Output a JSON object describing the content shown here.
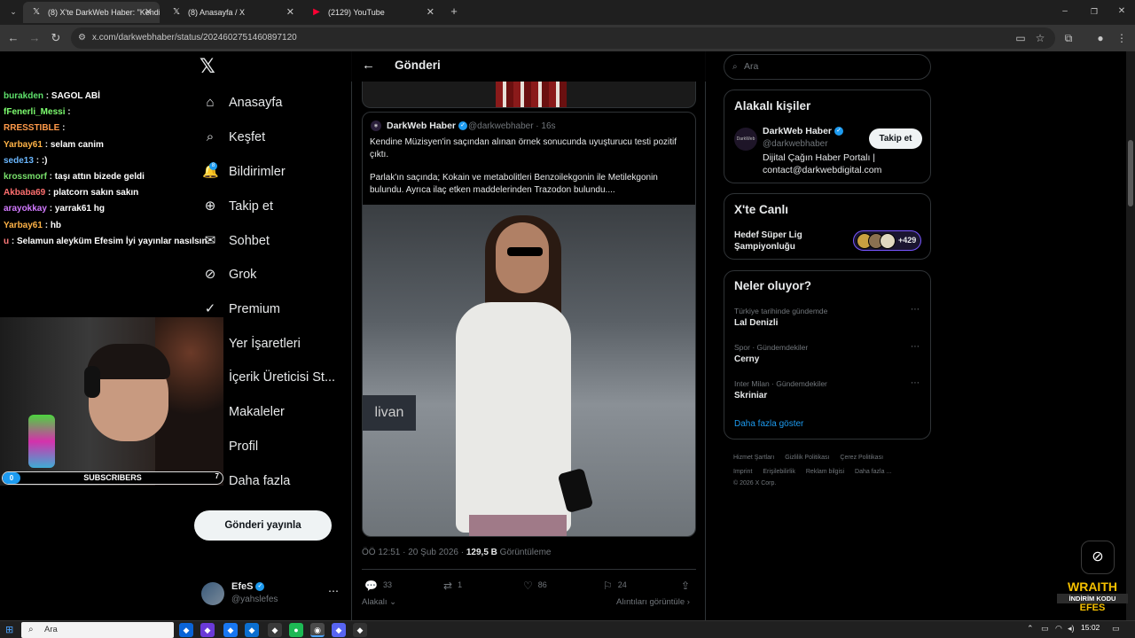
{
  "browser": {
    "tabs": [
      {
        "title": "(8) X'te DarkWeb Haber: \"Kendi",
        "favicon": "x-icon",
        "active": true
      },
      {
        "title": "(8) Anasayfa / X",
        "favicon": "x-icon",
        "active": false
      },
      {
        "title": "(2129) YouTube",
        "favicon": "youtube-icon",
        "active": false
      }
    ],
    "new_tab_label": "+",
    "url": "x.com/darkwebhaber/status/2024602751460897120"
  },
  "chat": [
    {
      "user": "burakden",
      "color": "#5ee06b",
      "message": "SAGOL ABİ"
    },
    {
      "user": "fFenerli_Messi",
      "color": "#7dff6f",
      "message": ""
    },
    {
      "user": "RRESSTIBLE",
      "color": "#ff9a4a",
      "message": ""
    },
    {
      "user": "Yarbay61",
      "color": "#ffb347",
      "message": "selam canim"
    },
    {
      "user": "sede13",
      "color": "#6ab7ff",
      "message": ":)"
    },
    {
      "user": "krossmorf",
      "color": "#78e06b",
      "message": "taşı attın bizede geldi"
    },
    {
      "user": "Akbaba69",
      "color": "#ff6f6f",
      "message": "platcorn sakın sakın"
    },
    {
      "user": "arayokkay",
      "color": "#d27aff",
      "message": "yarrak61 hg"
    },
    {
      "user": "Yarbay61",
      "color": "#ffb347",
      "message": "hb"
    },
    {
      "user": "u",
      "color": "#ff7a7a",
      "message": "Selamun aleyküm Efesim İyi yayınlar nasılsın."
    }
  ],
  "subscribers": {
    "count": "0",
    "label": "SUBSCRIBERS",
    "goal": "7"
  },
  "nav": {
    "items": [
      {
        "label": "Anasayfa",
        "icon": "home-icon",
        "glyph": "⌂"
      },
      {
        "label": "Keşfet",
        "icon": "search-icon",
        "glyph": "⌕"
      },
      {
        "label": "Bildirimler",
        "icon": "bell-icon",
        "glyph": "🔔"
      },
      {
        "label": "Takip et",
        "icon": "follow-icon",
        "glyph": "⊕"
      },
      {
        "label": "Sohbet",
        "icon": "mail-icon",
        "glyph": "✉"
      },
      {
        "label": "Grok",
        "icon": "grok-icon",
        "glyph": "⊘"
      },
      {
        "label": "Premium",
        "icon": "premium-icon",
        "glyph": "✓"
      },
      {
        "label": "Yer İşaretleri",
        "icon": "bookmark-icon",
        "glyph": "⚑"
      },
      {
        "label": "İçerik Üreticisi St...",
        "icon": "creator-icon",
        "glyph": "▤"
      },
      {
        "label": "Makaleler",
        "icon": "articles-icon",
        "glyph": "▦"
      },
      {
        "label": "Profil",
        "icon": "profile-icon",
        "glyph": "◯"
      },
      {
        "label": "Daha fazla",
        "icon": "more-icon",
        "glyph": "⋯"
      }
    ],
    "notif_badge": "8",
    "post_button": "Gönderi yayınla",
    "me": {
      "name": "EfeS",
      "handle": "@yahslefes"
    }
  },
  "post": {
    "header": "Gönderi",
    "quote": {
      "name": "DarkWeb Haber",
      "handle": "@darkwebhaber",
      "time": "16s",
      "text1": "Kendine Müzisyen'in saçından alınan örnek sonucunda uyuşturucu testi pozitif çıktı.",
      "text2": "Parlak'ın saçında; Kokain ve metabolitleri Benzoilekgonin ile Metilekgonin bulundu. Ayrıca ilaç etken maddelerinden Trazodon bulundu....",
      "photo_sign": "livan"
    },
    "timestamp": "ÖÖ 12:51 · 20 Şub 2026",
    "views_count": "129,5 B",
    "views_label": "Görüntüleme",
    "replies": "33",
    "reposts": "1",
    "likes": "86",
    "bookmarks": "24",
    "related_label": "Alakalı",
    "quotes_label": "Alıntıları görüntüle"
  },
  "right": {
    "search_placeholder": "Ara",
    "relevant": {
      "title": "Alakalı kişiler",
      "name": "DarkWeb Haber",
      "handle": "@darkwebhaber",
      "bio": "Dijital Çağın Haber Portalı | contact@darkwebdigital.com",
      "follow": "Takip et",
      "avatar_text": "DarkWeb"
    },
    "live": {
      "title": "X'te Canlı",
      "topic": "Hedef Süper Lig Şampiyonluğu",
      "count": "+429"
    },
    "trends": {
      "title": "Neler oluyor?",
      "items": [
        {
          "context": "Türkiye tarihinde gündemde",
          "name": "Lal Denizli"
        },
        {
          "context": "Spor · Gündemdekiler",
          "name": "Cerny"
        },
        {
          "context": "Inter Milan · Gündemdekiler",
          "name": "Skriniar"
        }
      ],
      "show_more": "Daha fazla göster"
    },
    "footer": [
      "Hizmet Şartları",
      "Gizlilik Politikası",
      "Çerez Politikası",
      "Imprint",
      "Erişilebilirlik",
      "Reklam bilgisi",
      "Daha fazla ...",
      "© 2026 X Corp."
    ]
  },
  "overlay": {
    "line1": "WRAITH",
    "line2": "İNDİRİM KODU",
    "line3": "EFES"
  },
  "taskbar": {
    "search": "Ara",
    "time": "15:02"
  }
}
